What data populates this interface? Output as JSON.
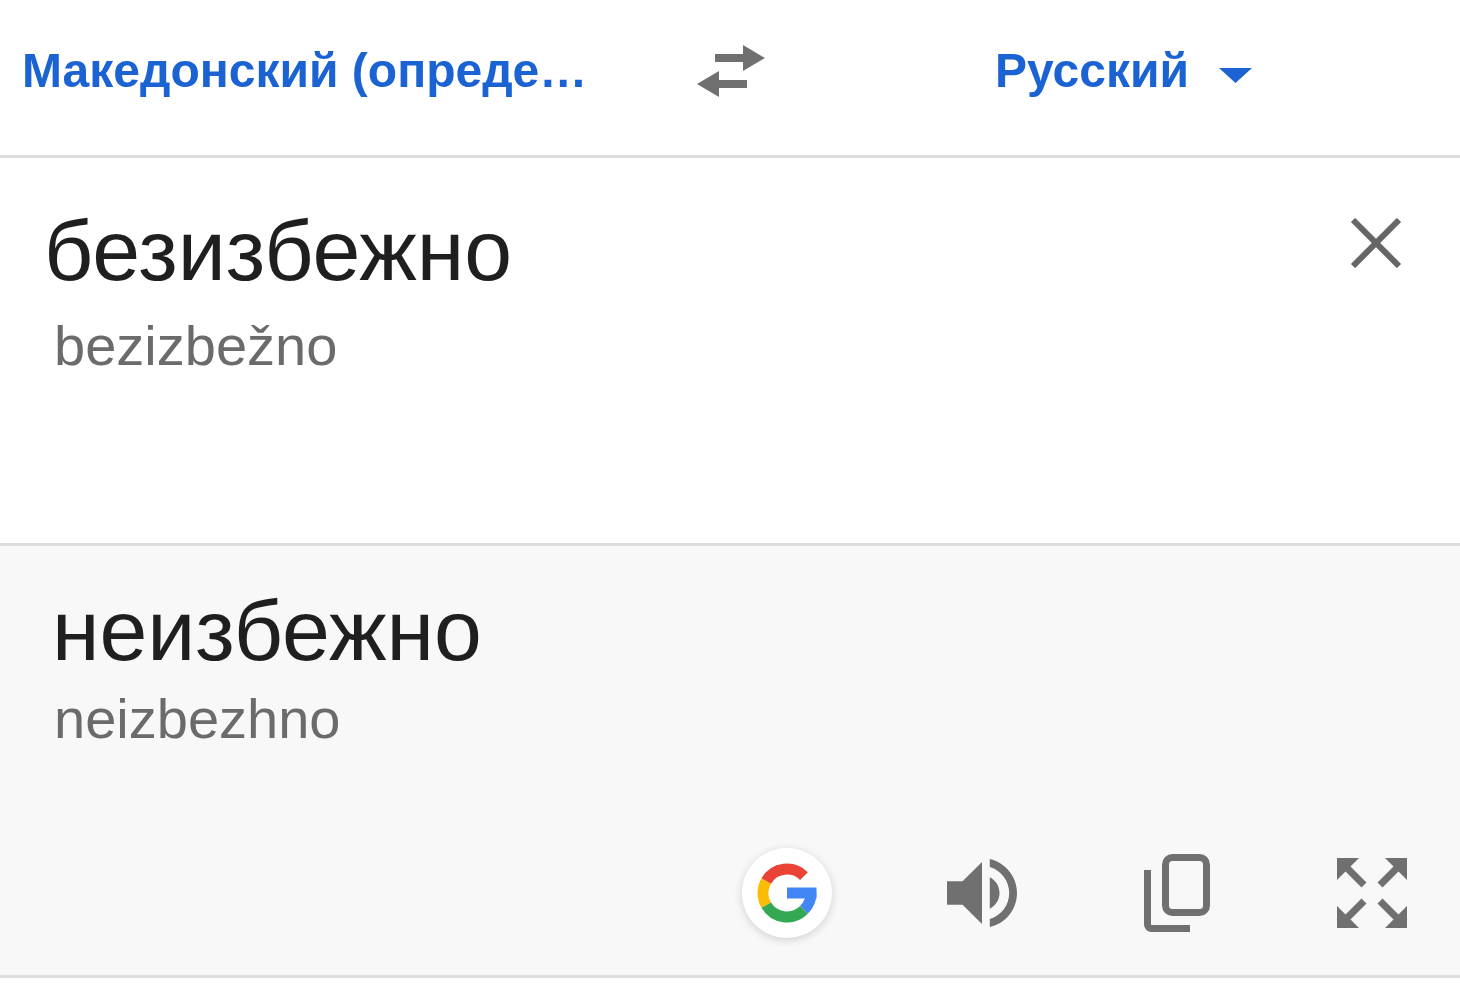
{
  "header": {
    "source_language": "Македонский (опреде…",
    "target_language": "Русский"
  },
  "input": {
    "text": "безизбежно",
    "transliteration": "bezizbežno"
  },
  "output": {
    "text": "неизбежно",
    "transliteration": "neizbezhno"
  }
}
